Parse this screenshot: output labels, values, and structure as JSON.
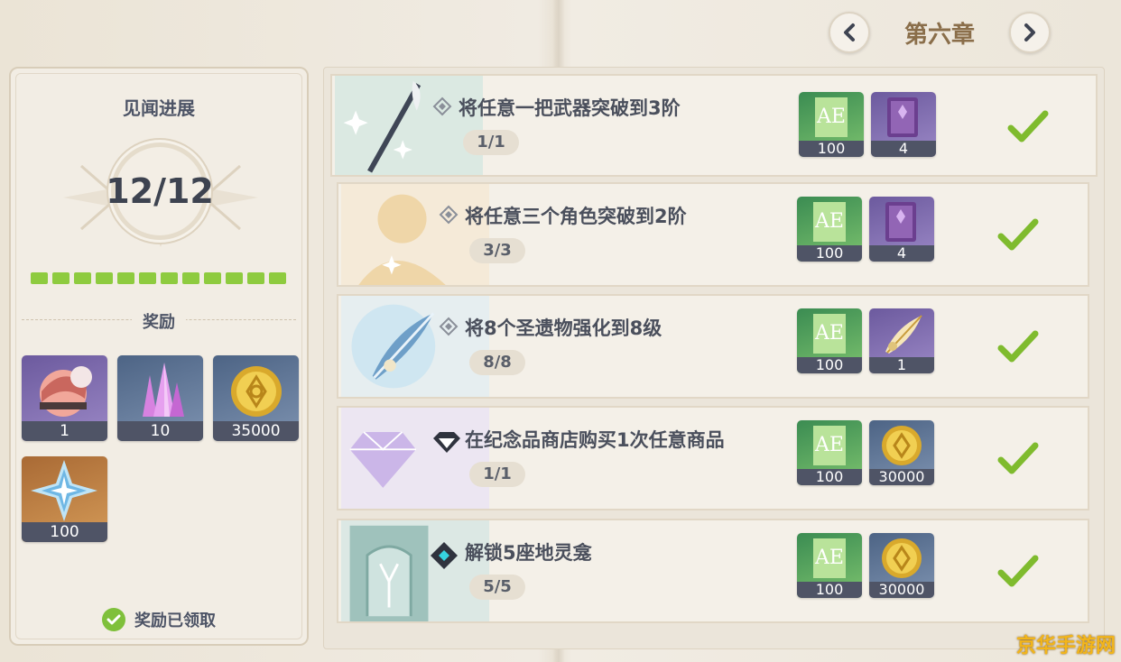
{
  "chapter": {
    "title": "第六章"
  },
  "progress": {
    "title": "见闻进展",
    "count": "12/12",
    "segments": 12,
    "rewards_label": "奖励",
    "rewards": [
      {
        "icon": "character-namecard-icon",
        "qty": "1"
      },
      {
        "icon": "crystal-icon",
        "qty": "10"
      },
      {
        "icon": "mora-coin-icon",
        "qty": "35000"
      },
      {
        "icon": "primogem-icon",
        "qty": "100"
      }
    ],
    "claimed_text": "奖励已领取"
  },
  "tasks": [
    {
      "desc": "将任意一把武器突破到3阶",
      "count": "1/1",
      "rewards": [
        {
          "icon": "adventure-exp-icon",
          "qty": "100"
        },
        {
          "icon": "hero-wit-book-icon",
          "qty": "4"
        }
      ]
    },
    {
      "desc": "将任意三个角色突破到2阶",
      "count": "3/3",
      "rewards": [
        {
          "icon": "adventure-exp-icon",
          "qty": "100"
        },
        {
          "icon": "hero-wit-book-icon",
          "qty": "4"
        }
      ]
    },
    {
      "desc": "将8个圣遗物强化到8级",
      "count": "8/8",
      "rewards": [
        {
          "icon": "adventure-exp-icon",
          "qty": "100"
        },
        {
          "icon": "artifact-feather-icon",
          "qty": "1"
        }
      ]
    },
    {
      "desc": "在纪念品商店购买1次任意商品",
      "count": "1/1",
      "rewards": [
        {
          "icon": "adventure-exp-icon",
          "qty": "100"
        },
        {
          "icon": "mora-coin-icon",
          "qty": "30000"
        }
      ]
    },
    {
      "desc": "解锁5座地灵龛",
      "count": "5/5",
      "rewards": [
        {
          "icon": "adventure-exp-icon",
          "qty": "100"
        },
        {
          "icon": "mora-coin-icon",
          "qty": "30000"
        }
      ]
    }
  ],
  "watermark": "京华手游网",
  "colors": {
    "accent_green": "#8ecb3f",
    "qty_bar": "#4f5466",
    "chapter": "#8a6e4a"
  }
}
